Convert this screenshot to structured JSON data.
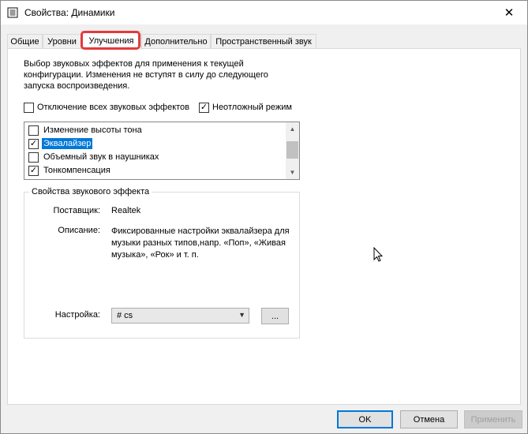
{
  "window": {
    "title": "Свойства: Динамики",
    "close_glyph": "✕"
  },
  "tabs": [
    {
      "label": "Общие",
      "active": false
    },
    {
      "label": "Уровни",
      "active": false
    },
    {
      "label": "Улучшения",
      "active": true
    },
    {
      "label": "Дополнительно",
      "active": false
    },
    {
      "label": "Пространственный звук",
      "active": false
    }
  ],
  "enhancements": {
    "description": "Выбор звуковых эффектов для применения к текущей конфигурации. Изменения не вступят в силу до следующего запуска воспроизведения.",
    "disable_all": {
      "label": "Отключение всех звуковых эффектов",
      "checked": false
    },
    "immediate_mode": {
      "label": "Неотложный режим",
      "checked": true
    },
    "effects": [
      {
        "label": "Изменение высоты тона",
        "checked": false,
        "selected": false
      },
      {
        "label": "Эквалайзер",
        "checked": true,
        "selected": true
      },
      {
        "label": "Объемный звук в наушниках",
        "checked": false,
        "selected": false
      },
      {
        "label": "Тонкомпенсация",
        "checked": true,
        "selected": false
      }
    ],
    "properties": {
      "title": "Свойства звукового эффекта",
      "provider_label": "Поставщик:",
      "provider_value": "Realtek",
      "description_label": "Описание:",
      "description_value": "Фиксированные настройки эквалайзера для музыки разных типов,напр. «Поп», «Живая музыка», «Рок» и т. п.",
      "setting_label": "Настройка:",
      "setting_value": "# cs",
      "more_button": "..."
    }
  },
  "footer": {
    "ok": "OK",
    "cancel": "Отмена",
    "apply": "Применить"
  },
  "colors": {
    "selection": "#0078d7",
    "highlight_annotation": "#e33b3b"
  },
  "icons": {
    "title": "speaker-icon",
    "scroll_up": "▲",
    "scroll_down": "▼",
    "combo_arrow": "▼",
    "check": "✓"
  }
}
